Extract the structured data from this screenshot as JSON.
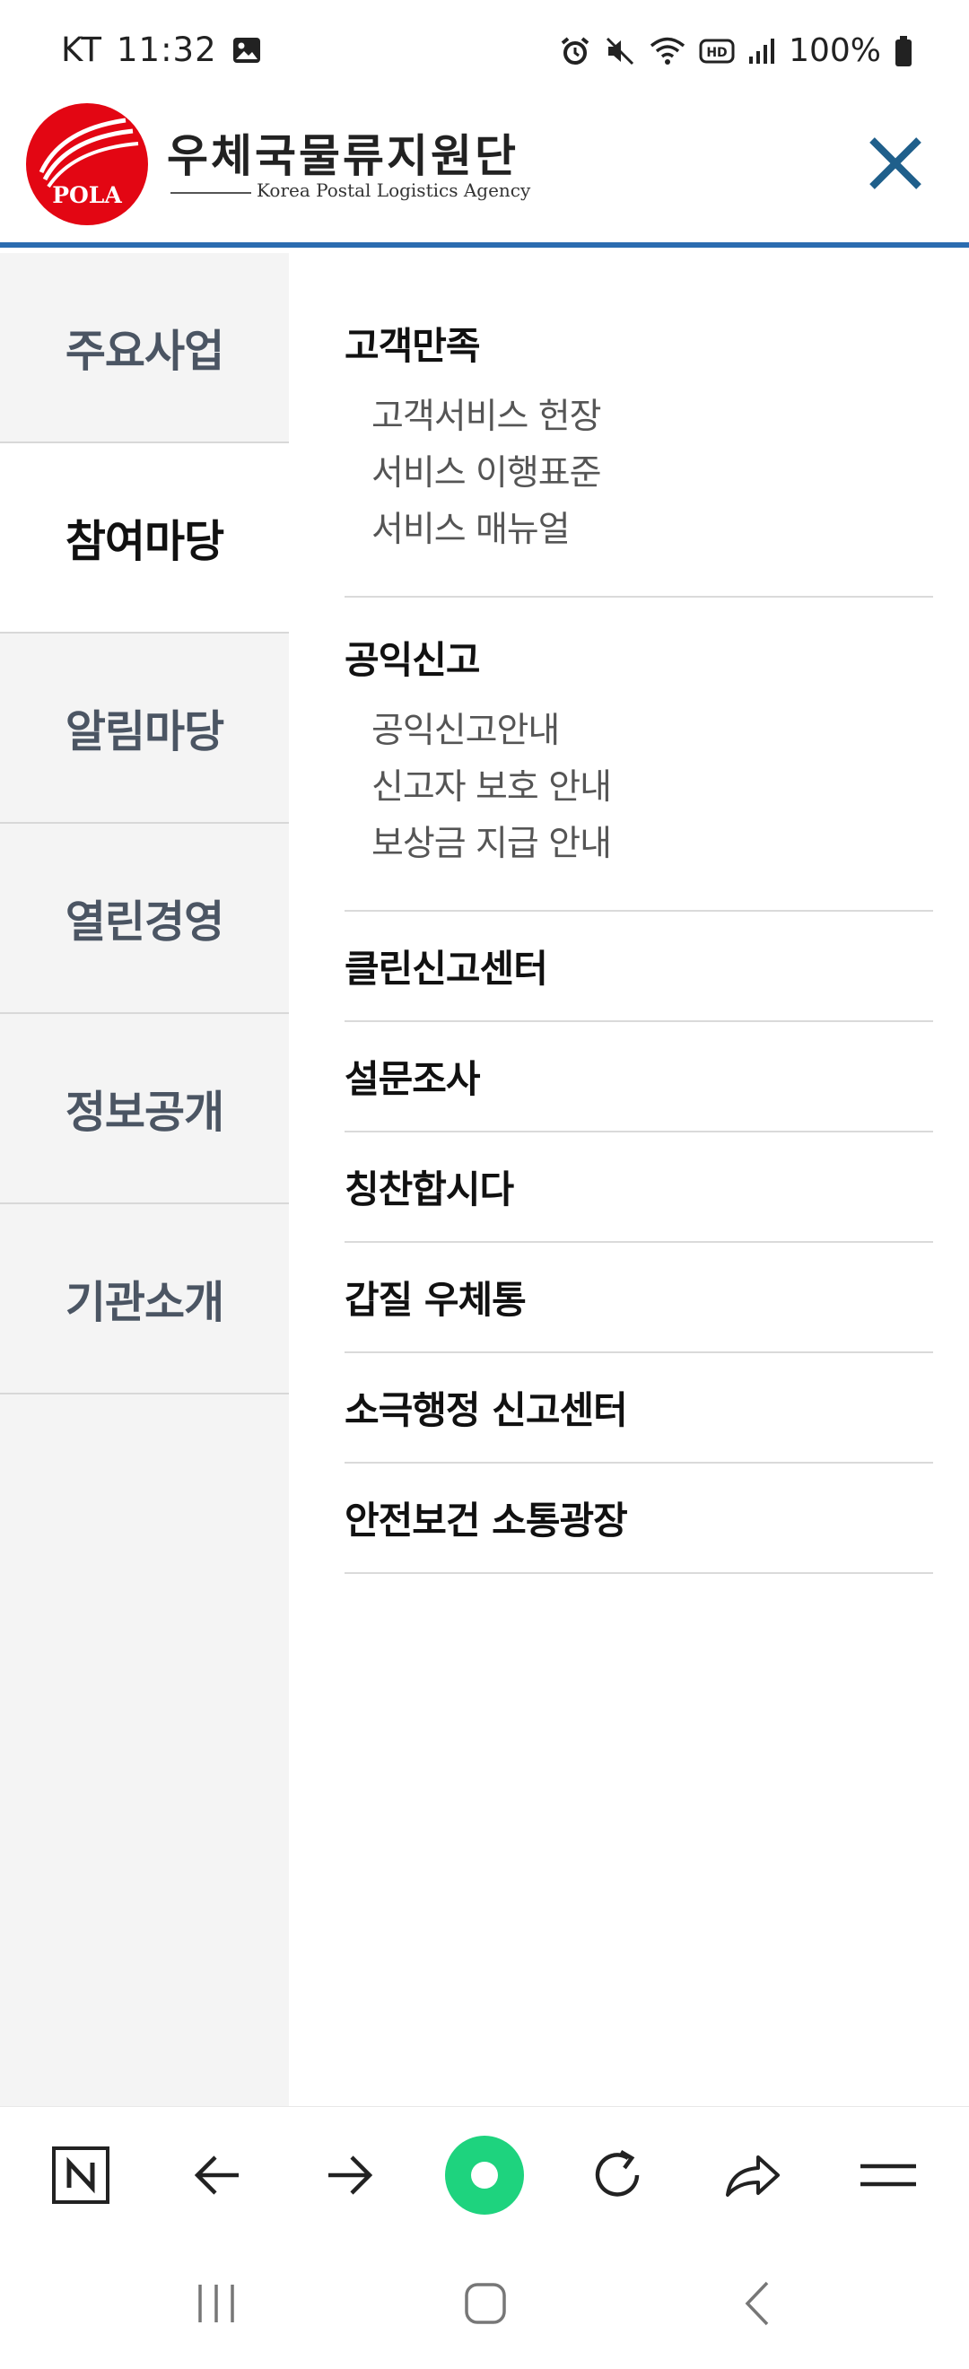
{
  "status_bar": {
    "carrier": "KT",
    "time": "11:32",
    "battery": "100%",
    "icons": [
      "image-icon",
      "alarm-icon",
      "mute-icon",
      "wifi-icon",
      "hd-icon",
      "signal-icon",
      "battery-icon"
    ]
  },
  "header": {
    "logo_text": "POLA",
    "title": "우체국물류지원단",
    "subtitle": "Korea Postal Logistics Agency",
    "close_icon": "close-icon"
  },
  "left_nav": {
    "items": [
      {
        "label": "주요사업",
        "active": false
      },
      {
        "label": "참여마당",
        "active": true
      },
      {
        "label": "알림마당",
        "active": false
      },
      {
        "label": "열린경영",
        "active": false
      },
      {
        "label": "정보공개",
        "active": false
      },
      {
        "label": "기관소개",
        "active": false
      }
    ]
  },
  "submenu": {
    "groups": [
      {
        "title": "고객만족",
        "items": [
          "고객서비스 헌장",
          "서비스 이행표준",
          "서비스 매뉴얼"
        ]
      },
      {
        "title": "공익신고",
        "items": [
          "공익신고안내",
          "신고자 보호 안내",
          "보상금 지급 안내"
        ]
      }
    ],
    "singles": [
      "클린신고센터",
      "설문조사",
      "칭찬합시다",
      "갑질 우체통",
      "소극행정 신고센터",
      "안전보건 소통광장"
    ]
  },
  "browser_toolbar": {
    "buttons": [
      "naver-icon",
      "back-arrow-icon",
      "forward-arrow-icon",
      "green-dot-icon",
      "refresh-icon",
      "share-icon",
      "menu-icon"
    ]
  },
  "system_nav": {
    "buttons": [
      "recent-apps-icon",
      "home-icon",
      "back-icon"
    ]
  },
  "colors": {
    "accent_blue": "#2b6cb0",
    "close_icon": "#1f5f8b",
    "logo_red": "#e30613",
    "green_button": "#1ed37e"
  }
}
